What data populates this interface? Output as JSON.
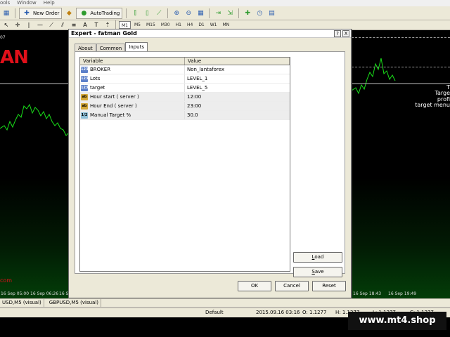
{
  "menu": {
    "items": [
      "ools",
      "Window",
      "Help"
    ]
  },
  "toolbar": {
    "new_order": "New Order",
    "autotrading": "AutoTrading",
    "timeframes": [
      "M1",
      "M5",
      "M15",
      "M30",
      "H1",
      "H4",
      "D1",
      "W1",
      "MN"
    ],
    "active_timeframe": "M1"
  },
  "chart_left": {
    "top_number": "07",
    "logo_text": "AN",
    "red_text": "com",
    "time_ticks": [
      "16 Sep 05:00",
      "16 Sep 06:26",
      "16 S"
    ]
  },
  "chart_right": {
    "texts": [
      "T",
      "Targe",
      "profi",
      "target menu"
    ],
    "time_ticks": [
      "16 Sep 18:43",
      "16 Sep 19:49"
    ]
  },
  "dialog": {
    "title": "Expert - fatman Gold",
    "help_button": "?",
    "close_button": "X",
    "tabs": [
      {
        "label": "About",
        "active": false
      },
      {
        "label": "Common",
        "active": false
      },
      {
        "label": "Inputs",
        "active": true
      }
    ],
    "table": {
      "columns": [
        "Variable",
        "Value"
      ],
      "rows": [
        {
          "icon": "enum",
          "icon_text": "123",
          "variable": "BROKER",
          "value": "Non_lantaforex"
        },
        {
          "icon": "enum",
          "icon_text": "123",
          "variable": "Lots",
          "value": "LEVEL_1"
        },
        {
          "icon": "enum",
          "icon_text": "123",
          "variable": "target",
          "value": "LEVEL_5"
        },
        {
          "icon": "string",
          "icon_text": "ab",
          "variable": "Hour start ( server )",
          "value": "12:00"
        },
        {
          "icon": "string",
          "icon_text": "ab",
          "variable": "Hour End ( server )",
          "value": "23:00"
        },
        {
          "icon": "double",
          "icon_text": "1/2",
          "variable": "Manual Target %",
          "value": "30.0"
        }
      ]
    },
    "load_button": "Load",
    "save_button": "Save",
    "ok_button": "OK",
    "cancel_button": "Cancel",
    "reset_button": "Reset"
  },
  "chart_tabs": [
    "USD,M5 (visual)",
    "GBPUSD,M5 (visual)"
  ],
  "status": {
    "profile": "Default",
    "datetime": "2015.09.16 03:16",
    "open": "O: 1.1277",
    "high": "H: 1.1277",
    "low": "L: 1.1277",
    "close": "C: 1.1277"
  },
  "watermark": "www.mt4.shop",
  "colors": {
    "chart_bg": "#000000",
    "candle_green": "#19e019",
    "logo_red": "#e0101a",
    "dialog_bg": "#ece9d8"
  }
}
